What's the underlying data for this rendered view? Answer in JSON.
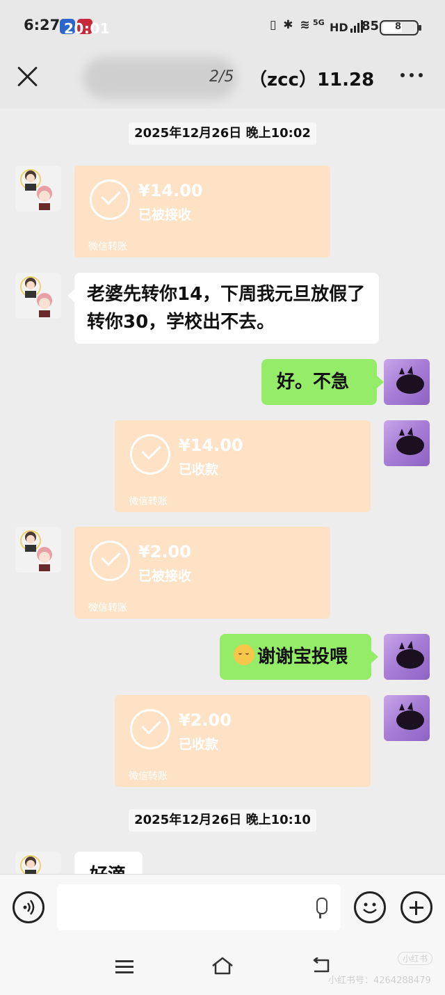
{
  "status_bar": {
    "time": "6:27",
    "overlay_time": "20:01",
    "signal_text": "5G",
    "hd_label": "HD",
    "battery_text": "85",
    "battery_small": "8"
  },
  "header": {
    "page_indicator": "2/5",
    "title": "（zcc）11.28"
  },
  "timestamps": {
    "first": "2025年12月26日 晚上10:02",
    "second": "2025年12月26日 晚上10:10"
  },
  "messages": [
    {
      "side": "in",
      "type": "transfer",
      "amount": "¥14.00",
      "status": "已被接收",
      "brand": "微信转账"
    },
    {
      "side": "in",
      "type": "text",
      "text": "老婆先转你14，下周我元旦放假了转你30，学校出不去。"
    },
    {
      "side": "out",
      "type": "text",
      "text": "好。不急"
    },
    {
      "side": "out",
      "type": "transfer",
      "amount": "¥14.00",
      "status": "已收款",
      "brand": "微信转账"
    },
    {
      "side": "in",
      "type": "transfer",
      "amount": "¥2.00",
      "status": "已被接收",
      "brand": "微信转账"
    },
    {
      "side": "out",
      "type": "text",
      "text": "谢谢宝投喂",
      "emoji": "kissing-face"
    },
    {
      "side": "out",
      "type": "transfer",
      "amount": "¥2.00",
      "status": "已收款",
      "brand": "微信转账"
    },
    {
      "side": "in",
      "type": "text",
      "text": "好滴"
    }
  ],
  "watermark": {
    "text": "小红书号：4264288479",
    "badge": "小红书"
  },
  "icons": {
    "voice": "voice-icon",
    "mic": "mic-icon",
    "emoji": "emoji-icon",
    "plus": "plus-icon",
    "close": "close-icon",
    "more": "more-icon"
  }
}
